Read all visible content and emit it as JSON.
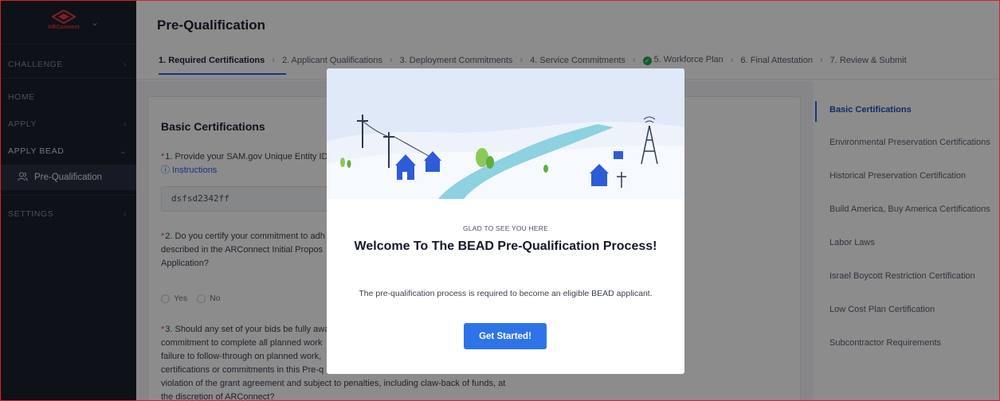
{
  "app": {
    "logo_text": "ARConnect"
  },
  "sidebar": {
    "items": [
      {
        "label": "CHALLENGE",
        "has_arrow": true
      },
      {
        "label": "HOME",
        "has_arrow": false
      },
      {
        "label": "APPLY",
        "has_arrow": true
      },
      {
        "label": "APPLY BEAD",
        "expanded": true
      },
      {
        "label": "SETTINGS",
        "has_arrow": true
      }
    ],
    "sub_item": {
      "label": "Pre-Qualification",
      "icon": "users-icon"
    }
  },
  "header": {
    "title": "Pre-Qualification",
    "steps": [
      {
        "label": "1. Required Certifications",
        "active": true
      },
      {
        "label": "2. Applicant Qualifications"
      },
      {
        "label": "3. Deployment Commitments"
      },
      {
        "label": "4. Service Commitments"
      },
      {
        "label": "5. Workforce Plan",
        "completed": true
      },
      {
        "label": "6. Final Attestation"
      },
      {
        "label": "7. Review & Submit"
      }
    ]
  },
  "main": {
    "section_title": "Basic Certifications",
    "q1": {
      "text": "1. Provide your SAM.gov Unique Entity ID",
      "instructions": "Instructions",
      "value": "dsfsd2342ff"
    },
    "q2": {
      "line1": "2. Do you certify your commitment to adh",
      "line2": "described in the ARConnect Initial Propos",
      "line3": "Application?",
      "yes": "Yes",
      "no": "No"
    },
    "q3": {
      "line1": "3. Should any set of your bids be fully awa",
      "line2": "commitment to complete all planned work",
      "line3": "failure to follow-through on planned work,",
      "line4": "certifications or commitments in this Pre-q",
      "line5": "violation of the grant agreement and subject to penalties, including claw-back of funds, at",
      "line6": "the discretion of ARConnect?"
    }
  },
  "right_panel": {
    "items": [
      {
        "label": "Basic Certifications",
        "active": true
      },
      {
        "label": "Environmental Preservation Certifications"
      },
      {
        "label": "Historical Preservation Certification"
      },
      {
        "label": "Build America, Buy America Certifications"
      },
      {
        "label": "Labor Laws"
      },
      {
        "label": "Israel Boycott Restriction Certification"
      },
      {
        "label": "Low Cost Plan Certification"
      },
      {
        "label": "Subcontractor Requirements"
      }
    ]
  },
  "modal": {
    "kicker": "GLAD TO SEE YOU HERE",
    "title": "Welcome To The BEAD Pre-Qualification Process!",
    "description": "The pre-qualification process is required to become an eligible BEAD applicant.",
    "button": "Get Started!"
  },
  "colors": {
    "accent": "#2563eb",
    "sidebar_bg": "#1b1f2c",
    "button": "#2e74e8",
    "brand_red": "#e23a4a",
    "success": "#2ea44f"
  }
}
